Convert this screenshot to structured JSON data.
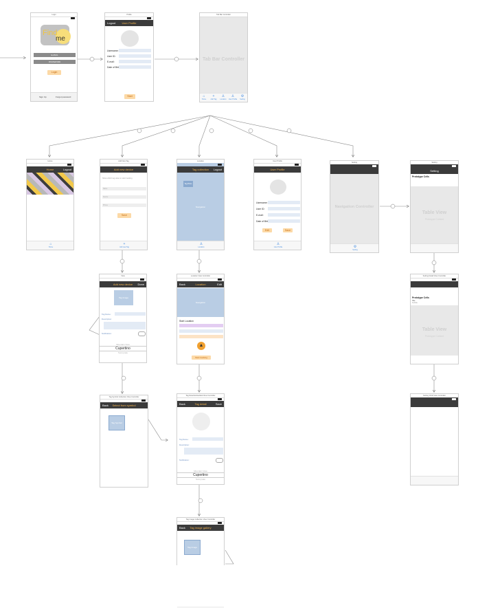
{
  "scenes": {
    "login": {
      "title": "Login",
      "logo_a": "Find",
      "logo_b": "me",
      "email": "E-MAIL",
      "password": "PASSWORD",
      "login": "Login",
      "signup": "Sign Up",
      "forgot": "Forgot password"
    },
    "profile_edit": {
      "title": "Profile",
      "nav_left": "Logout",
      "nav_center": "User Profile",
      "username": "Username:",
      "userid": "User ID:",
      "email": "E-mail:",
      "dob": "Date of Birth:",
      "start": "Start"
    },
    "tabbar_ctrl": {
      "title": "Tab Bar Controller",
      "center": "Tab Bar Controller",
      "tabs": [
        "Home",
        "Add Tag",
        "Location",
        "User Profile",
        "Setting"
      ]
    },
    "home": {
      "title": "Home",
      "nav_center": "Home",
      "nav_right": "Logout",
      "tab": "Home"
    },
    "add_tag": {
      "title": "Add New Tag",
      "nav_center": "Add new device",
      "hint": "Show which tag value to start tracking",
      "f1": "Name",
      "f2": "Device",
      "f3": "Phone",
      "save": "Save",
      "tab": "Add new Tag"
    },
    "location": {
      "title": "Location",
      "nav_center": "Tag collection",
      "nav_right": "Logout",
      "photo": "Tag Photo",
      "map": "Navigation",
      "tab": "Location"
    },
    "user_profile": {
      "title": "User Profile",
      "nav_center": "User Profile",
      "username": "Username:",
      "userid": "User ID:",
      "email": "E-mail:",
      "dob": "Date of Birth:",
      "edit": "Edit",
      "save": "Save",
      "tab": "User Profile"
    },
    "nav_ctrl": {
      "title": "Setting",
      "center": "Navigation Controller",
      "tab": "Setting"
    },
    "setting": {
      "title": "Setting",
      "nav_center": "Setting",
      "row": "Prototype Cells",
      "tv": "Table View",
      "tv_sub": "Prototype Content"
    },
    "add_device": {
      "title": "View",
      "nav_center": "Add new device",
      "nav_right": "Done",
      "photo": "Tag Image",
      "tagname": "Tag Name:",
      "desc": "Description:",
      "notif": "Notification:",
      "picker_top": "Mountain View",
      "picker_mid": "Cupertino",
      "picker_bot": "Sunnyvale"
    },
    "loc_detail": {
      "title": "Location View Controller",
      "nav_left": "Back",
      "nav_center": "Location",
      "nav_right": "Edit",
      "map": "Navigation",
      "start_loc": "Start Location",
      "start_btn": "Start tracking"
    },
    "setting_detail": {
      "title": "Setting Detail View Controller",
      "row": "Prototype Cells",
      "row_sub": "Title",
      "row_sub2": "Subtitle",
      "tv": "Table View",
      "tv_sub": "Prototype Content"
    },
    "select_symbol": {
      "title": "Tag Symbol Collection View Controller",
      "nav_left": "Back",
      "nav_center": "Select from symbol",
      "cell": "Tag Symbol"
    },
    "tag_detail": {
      "title": "Tag Detail Embedded View Controller",
      "nav_left": "Back",
      "nav_center": "Tag detail",
      "nav_right": "Save",
      "tagname": "Tag Name:",
      "desc": "Description:",
      "notif": "Notification:",
      "picker_top": "Mountain View",
      "picker_mid": "Cupertino",
      "picker_bot": "Sunnyvale"
    },
    "setting_child": {
      "title": "Setting Child View Controller"
    },
    "gallery": {
      "title": "Tag Image Collection View Controller",
      "nav_left": "Back",
      "nav_center": "Tag image gallery",
      "cell": "Tag Image"
    }
  },
  "colors": {
    "accent": "#f3b34c",
    "nav": "#3b3b3b",
    "placeholder": "#b9cde4",
    "tint": "#4a90e2"
  }
}
